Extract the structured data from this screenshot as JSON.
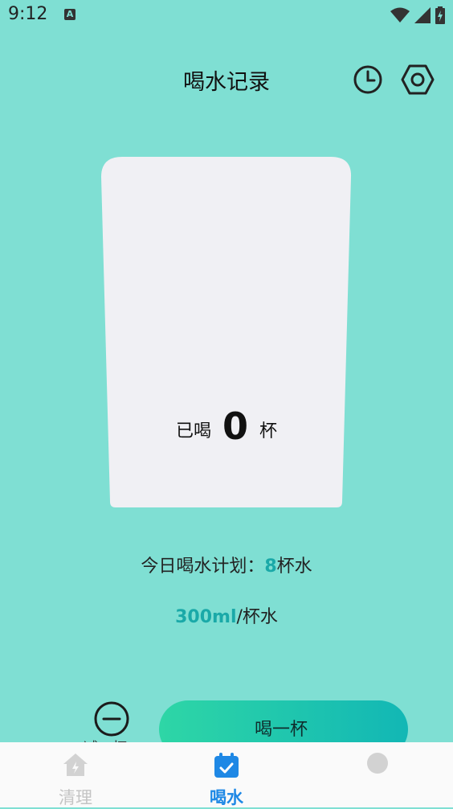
{
  "status": {
    "time": "9:12",
    "a_badge": "A"
  },
  "header": {
    "title": "喝水记录",
    "history_icon": "clock-icon",
    "settings_icon": "hexagon-settings-icon"
  },
  "cup": {
    "prefix": "已喝",
    "count": "0",
    "suffix": "杯"
  },
  "plan": {
    "label": "今日喝水计划：",
    "cups": "8",
    "unit": "杯水"
  },
  "per_cup": {
    "amount": "300ml",
    "unit": "/杯水"
  },
  "actions": {
    "drink_label": "喝一杯",
    "minus_label": "减一杯"
  },
  "nav": {
    "items": [
      {
        "label": "清理",
        "icon": "house-bolt-icon",
        "active": false
      },
      {
        "label": "喝水",
        "icon": "calendar-check-icon",
        "active": true
      },
      {
        "label": "",
        "icon": "blob-icon",
        "active": false
      }
    ]
  },
  "colors": {
    "background": "#7fdfd3",
    "accent": "#1aa9a8",
    "nav_active": "#1e88e5",
    "nav_inactive": "#c9c9c9"
  }
}
